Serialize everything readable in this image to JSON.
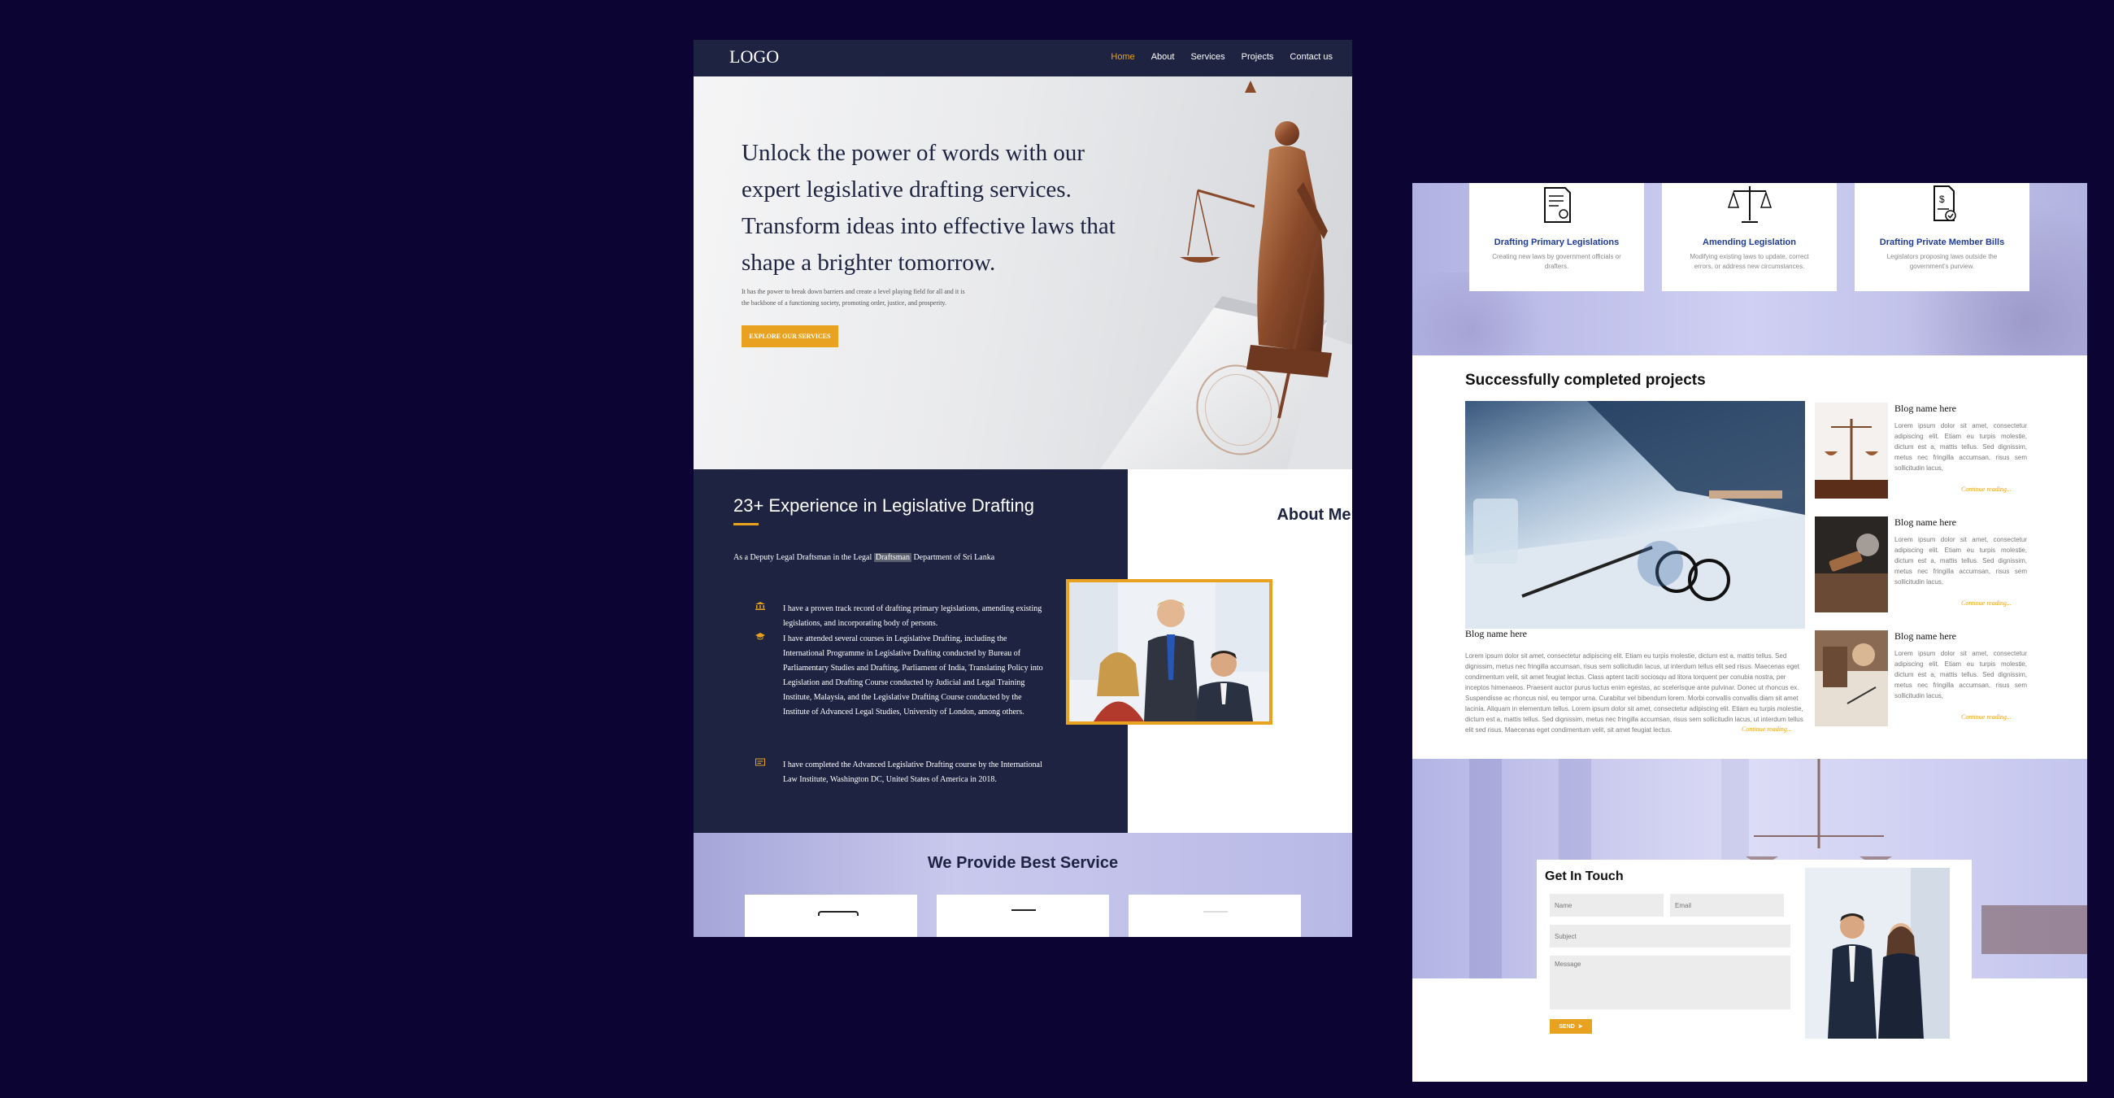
{
  "nav": {
    "logo": "LOGO",
    "items": [
      "Home",
      "About",
      "Services",
      "Projects",
      "Contact us"
    ]
  },
  "hero": {
    "title": "Unlock the power of words with our expert legislative drafting services. Transform ideas into effective laws that shape a brighter tomorrow.",
    "subtitle": "It has the power to break down barriers and create a level playing field for all and it is the backbone of a functioning society, promoting order, justice, and prosperity.",
    "button": "EXPLORE OUR SERVICES"
  },
  "experience": {
    "title": "23+ Experience in Legislative Drafting",
    "intro_before": "As a Deputy Legal Draftsman in the Legal ",
    "intro_highlight": "Draftsman",
    "intro_after": " Department of Sri Lanka",
    "items": [
      "I have a proven track record of drafting primary legislations, amending existing legislations, and incorporating body of persons.",
      "I have attended several courses in Legislative Drafting, including the International Programme in Legislative Drafting conducted by Bureau of Parliamentary Studies and Drafting, Parliament of India, Translating Policy into Legislation and Drafting Course conducted by Judicial and Legal Training Institute, Malaysia, and the Legislative Drafting Course conducted by the Institute of Advanced Legal Studies, University of London, among others.",
      "I have completed the Advanced Legislative Drafting course by the International Law Institute, Washington DC, United States of America in 2018."
    ]
  },
  "about": {
    "title": "About Me"
  },
  "services": {
    "title": "We Provide Best Service",
    "cards": [
      {
        "title": "Drafting Primary Legislations",
        "desc": "Creating new laws by government officials or drafters."
      },
      {
        "title": "Amending Legislation",
        "desc": "Modifying existing laws to update, correct errors, or address new circumstances."
      },
      {
        "title": "Drafting Private Member Bills",
        "desc": "Legislators proposing laws outside the government's purview."
      }
    ]
  },
  "projects": {
    "title": "Successfully completed projects",
    "main": {
      "name": "Blog name here",
      "text": "Lorem ipsum dolor sit amet, consectetur adipiscing elit. Etiam eu turpis molestie, dictum est a, mattis tellus. Sed dignissim, metus nec fringilla accumsan, risus sem sollicitudin lacus, ut interdum tellus elit sed risus. Maecenas eget condimentum velit, sit amet feugiat lectus. Class aptent taciti sociosqu ad litora torquent per conubia nostra, per inceptos himenaeos. Praesent auctor purus luctus enim egestas, ac scelerisque ante pulvinar. Donec ut rhoncus ex. Suspendisse ac rhoncus nisl, eu tempor urna. Curabitur vel bibendum lorem. Morbi convallis convallis diam sit amet lacinia. Aliquam in elementum tellus. Lorem ipsum dolor sit amet, consectetur adipiscing elit. Etiam eu turpis molestie, dictum est a, mattis tellus. Sed dignissim, metus nec fringilla accumsan, risus sem sollicitudin lacus, ut interdum tellus elit sed risus. Maecenas eget condimentum velit, sit amet feugiat lectus.",
      "continue": "Continue reading..."
    },
    "blogs": [
      {
        "name": "Blog name here",
        "text": "Lorem ipsum dolor sit amet, consectetur adipiscing elit. Etiam eu turpis molestie, dictum est a, mattis tellus. Sed dignissim, metus nec fringilla accumsan, risus sem sollicitudin lacus,",
        "continue": "Continue reading..."
      },
      {
        "name": "Blog name here",
        "text": "Lorem ipsum dolor sit amet, consectetur adipiscing elit. Etiam eu turpis molestie, dictum est a, mattis tellus. Sed dignissim, metus nec fringilla accumsan, risus sem sollicitudin lacus,",
        "continue": "Continue reading..."
      },
      {
        "name": "Blog name here",
        "text": "Lorem ipsum dolor sit amet, consectetur adipiscing elit. Etiam eu turpis molestie, dictum est a, mattis tellus. Sed dignissim, metus nec fringilla accumsan, risus sem sollicitudin lacus,",
        "continue": "Continue reading..."
      }
    ]
  },
  "contact": {
    "title": "Get In Touch",
    "name_placeholder": "Name",
    "email_placeholder": "Email",
    "subject_placeholder": "Subject",
    "message_placeholder": "Message",
    "send": "SEND"
  },
  "colors": {
    "navy": "#1d2340",
    "gold": "#e8a21f",
    "background": "#0c0533",
    "lavender": "#c9c9ee"
  }
}
